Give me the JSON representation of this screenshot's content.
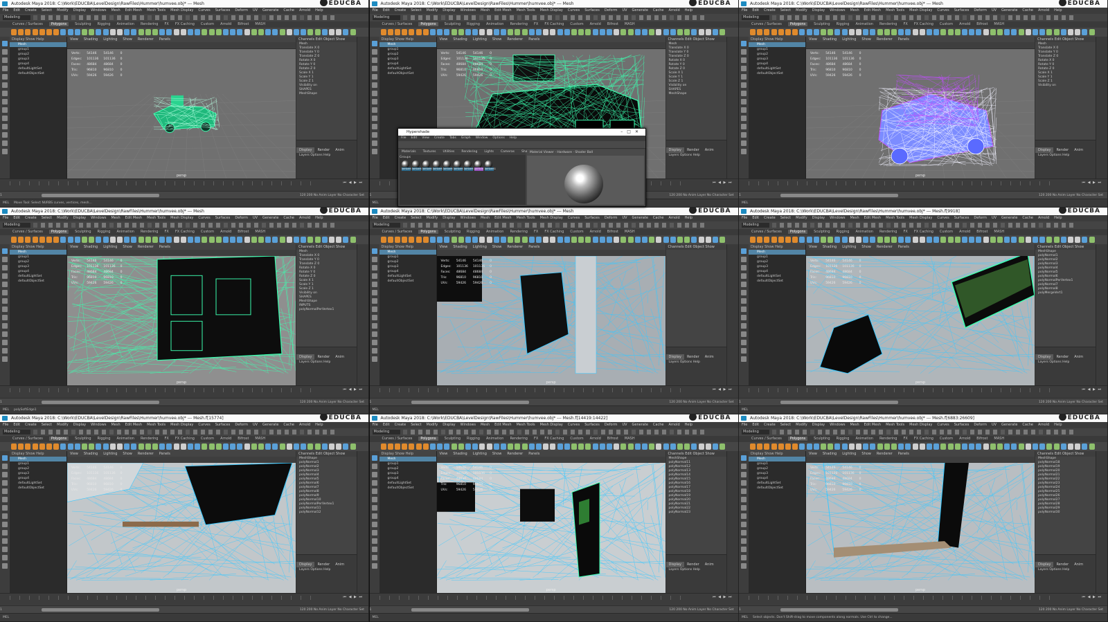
{
  "panels": [
    {
      "title": "Autodesk Maya 2018: C:\\Work\\EDUCBA\\LevelDesign\\RawFiles\\Hummer\\humvee.obj* --- Mesh",
      "variant": "green-small",
      "outliner": [
        "Mesh",
        "group1",
        "group2",
        "group3",
        "group4",
        "defaultLightSet",
        "defaultObjectSet"
      ],
      "channel_title": "Mesh",
      "channel_lines": [
        "Translate X 0",
        "Translate Y 0",
        "Translate Z 0",
        "Rotate X 0",
        "Rotate Y 0",
        "Rotate Z 0",
        "Scale X 1",
        "Scale Y 1",
        "Scale Z 1",
        "Visibility on",
        "SHAPES",
        "MeshShape"
      ],
      "cmd": "Move Tool: Select NURBS curves, vertices, mesh..."
    },
    {
      "title": "Autodesk Maya 2018: C:\\Work\\EDUCBA\\LevelDesign\\RawFiles\\Hummer\\humvee.obj* --- Mesh",
      "variant": "green-large",
      "outliner": [
        "Mesh",
        "group1",
        "group2",
        "group3",
        "group4",
        "defaultLightSet",
        "defaultObjectSet"
      ],
      "channel_title": "Mesh",
      "channel_lines": [
        "Translate X 0",
        "Translate Y 0",
        "Translate Z 0",
        "Rotate X 0",
        "Rotate Y 0",
        "Rotate Z 0",
        "Scale X 1",
        "Scale Y 1",
        "Scale Z 1",
        "Visibility on",
        "SHAPES",
        "MeshShape"
      ],
      "cmd": ""
    },
    {
      "title": "Autodesk Maya 2018: C:\\Work\\EDUCBA\\LevelDesign\\RawFiles\\Hummer\\humvee.obj* --- Mesh",
      "variant": "purple",
      "outliner": [
        "Mesh",
        "group1",
        "group2",
        "group3",
        "group4",
        "defaultLightSet",
        "defaultObjectSet"
      ],
      "channel_title": "Mesh",
      "channel_lines": [
        "Translate X 0",
        "Translate Y 0",
        "Translate Z 0",
        "Rotate X 0",
        "Rotate Y 0",
        "Rotate Z 0",
        "Scale X 1",
        "Scale Y 1",
        "Scale Z 1",
        "Visibility on"
      ],
      "cmd": ""
    },
    {
      "title": "Autodesk Maya 2018: C:\\Work\\EDUCBA\\LevelDesign\\RawFiles\\Hummer\\humvee.obj* --- Mesh",
      "variant": "closeup-green",
      "outliner": [
        "Mesh",
        "group1",
        "group2",
        "group3",
        "group4",
        "defaultLightSet",
        "defaultObjectSet"
      ],
      "channel_title": "Mesh",
      "channel_lines": [
        "Translate X 0",
        "Translate Y 0",
        "Translate Z 0",
        "Rotate X 0",
        "Rotate Y 0",
        "Rotate Z 0",
        "Scale X 1",
        "Scale Y 1",
        "Scale Z 1",
        "Visibility on",
        "SHAPES",
        "MeshShape",
        "INPUTS",
        "polyNormalPerVertex1"
      ],
      "cmd": "polySoftEdge1"
    },
    {
      "title": "Autodesk Maya 2018: C:\\Work\\EDUCBA\\LevelDesign\\RawFiles\\Hummer\\humvee.obj* --- Mesh",
      "variant": "closeup-grey",
      "outliner": [
        "Mesh",
        "group1",
        "group2",
        "group3",
        "group4",
        "defaultLightSet",
        "defaultObjectSet"
      ],
      "channel_title": "",
      "channel_lines": [],
      "cmd": ""
    },
    {
      "title": "Autodesk Maya 2018: C:\\Work\\EDUCBA\\LevelDesign\\RawFiles\\Hummer\\humvee.obj* --- Mesh.f[9918]",
      "variant": "closeup-select",
      "outliner": [
        "Mesh",
        "group1",
        "group2",
        "group3",
        "group4",
        "defaultLightSet",
        "defaultObjectSet"
      ],
      "channel_title": "MeshShape",
      "channel_lines": [
        "polyNormal1",
        "polyNormal2",
        "polyNormal3",
        "polyNormal4",
        "polyNormal5",
        "polyNormal6",
        "polyNormalPerVertex1",
        "polyNormal7",
        "polyNormal8",
        "polyMergeVert1"
      ],
      "cmd": ""
    },
    {
      "title": "Autodesk Maya 2018: C:\\Work\\EDUCBA\\LevelDesign\\RawFiles\\Hummer\\humvee.obj* --- Mesh.f[15774]",
      "variant": "closeup-bottom",
      "outliner": [
        "Mesh",
        "group1",
        "group2",
        "group3",
        "group4",
        "defaultLightSet",
        "defaultObjectSet"
      ],
      "channel_title": "MeshShape",
      "channel_lines": [
        "polyNormal1",
        "polyNormal2",
        "polyNormal3",
        "polyNormal4",
        "polyNormal5",
        "polyNormal6",
        "polyNormal7",
        "polyNormal8",
        "polyNormal9",
        "polyNormal10",
        "polyNormalPerVertex1",
        "polyNormal11",
        "polyNormal12"
      ],
      "cmd": ""
    },
    {
      "title": "Autodesk Maya 2018: C:\\Work\\EDUCBA\\LevelDesign\\RawFiles\\Hummer\\humvee.obj* --- Mesh.f[14419:14422]",
      "variant": "closeup-side",
      "outliner": [
        "Mesh",
        "group1",
        "group2",
        "group3",
        "group4",
        "defaultLightSet",
        "defaultObjectSet"
      ],
      "channel_title": "MeshShape",
      "channel_lines": [
        "polyNormal11",
        "polyNormal12",
        "polyNormal13",
        "polyNormal14",
        "polyNormal15",
        "polyNormal16",
        "polyNormal17",
        "polyNormal18",
        "polyNormal19",
        "polyNormal20",
        "polyNormal21",
        "polyNormal22",
        "polyNormal23"
      ],
      "cmd": ""
    },
    {
      "title": "Autodesk Maya 2018: C:\\Work\\EDUCBA\\LevelDesign\\RawFiles\\Hummer\\humvee.obj* --- Mesh.f[6883:26609]",
      "variant": "closeup-door",
      "outliner": [
        "Mesh",
        "group1",
        "group2",
        "group3",
        "group4",
        "defaultLightSet",
        "defaultObjectSet"
      ],
      "channel_title": "MeshShape",
      "channel_lines": [
        "polyNormal18",
        "polyNormal19",
        "polyNormal20",
        "polyNormal21",
        "polyNormal22",
        "polyNormal23",
        "polyNormal24",
        "polyNormal25",
        "polyNormal26",
        "polyNormal27",
        "polyNormal28",
        "polyNormal29",
        "polyNormal30"
      ],
      "cmd": "Select objects. Don't Shift-drag to move components along normals. Use Ctrl to change..."
    }
  ],
  "menubar": [
    "File",
    "Edit",
    "Create",
    "Select",
    "Modify",
    "Display",
    "Windows",
    "Mesh",
    "Edit Mesh",
    "Mesh Tools",
    "Mesh Display",
    "Curves",
    "Surfaces",
    "Deform",
    "UV",
    "Generate",
    "Cache",
    "Arnold",
    "Help"
  ],
  "mode": "Modeling",
  "shelf_tabs": [
    "Curves / Surfaces",
    "Polygons",
    "Sculpting",
    "Rigging",
    "Animation",
    "Rendering",
    "FX",
    "FX Caching",
    "Custom",
    "Arnold",
    "Bifrost",
    "MASH"
  ],
  "active_shelf": "Polygons",
  "viewport_menu": [
    "View",
    "Shading",
    "Lighting",
    "Show",
    "Renderer",
    "Panels"
  ],
  "outliner_menu": [
    "Display",
    "Show",
    "Help"
  ],
  "channel_menu": [
    "Channels",
    "Edit",
    "Object",
    "Show"
  ],
  "layer_tabs": [
    "Display",
    "Render",
    "Anim"
  ],
  "layer_menu": [
    "Layers",
    "Options",
    "Help"
  ],
  "hud": [
    [
      "Verts:",
      "54146",
      "54146",
      "0"
    ],
    [
      "Edges:",
      "101136",
      "101136",
      "0"
    ],
    [
      "Faces:",
      "48684",
      "48684",
      "0"
    ],
    [
      "Tris:",
      "96810",
      "96810",
      "0"
    ],
    [
      "UVs:",
      "59426",
      "59426",
      "0"
    ]
  ],
  "persp_label": "persp",
  "range": {
    "start": "1",
    "end": "120",
    "end2": "200",
    "anim_layer": "No Anim Layer",
    "char_set": "No Character Set"
  },
  "cmd_label": "MEL",
  "watermark": "EDUCBA",
  "hypershade": {
    "title": "Hypershade",
    "menu": [
      "File",
      "Edit",
      "View",
      "Create",
      "Tabs",
      "Graph",
      "Window",
      "Options",
      "Help"
    ],
    "browser_tabs": [
      "Materials",
      "Textures",
      "Utilities",
      "Rendering",
      "Lights",
      "Cameras",
      "Shading Groups"
    ],
    "material_names": [
      "lambert",
      "lambert",
      "lambert",
      "lambert",
      "lambert",
      "lambert",
      "lambert",
      "particle",
      "lambert1"
    ],
    "preview_label": "Material Viewer",
    "preview_mode": "Hardware",
    "preview_shape": "Shader Ball"
  },
  "colors": {
    "maya_bg": "#444444",
    "viewport": "#707070",
    "wire_green": "#3cffb0",
    "wire_purple": "#c14cff",
    "wire_blue": "#39c8ff",
    "select": "#5285a6"
  }
}
